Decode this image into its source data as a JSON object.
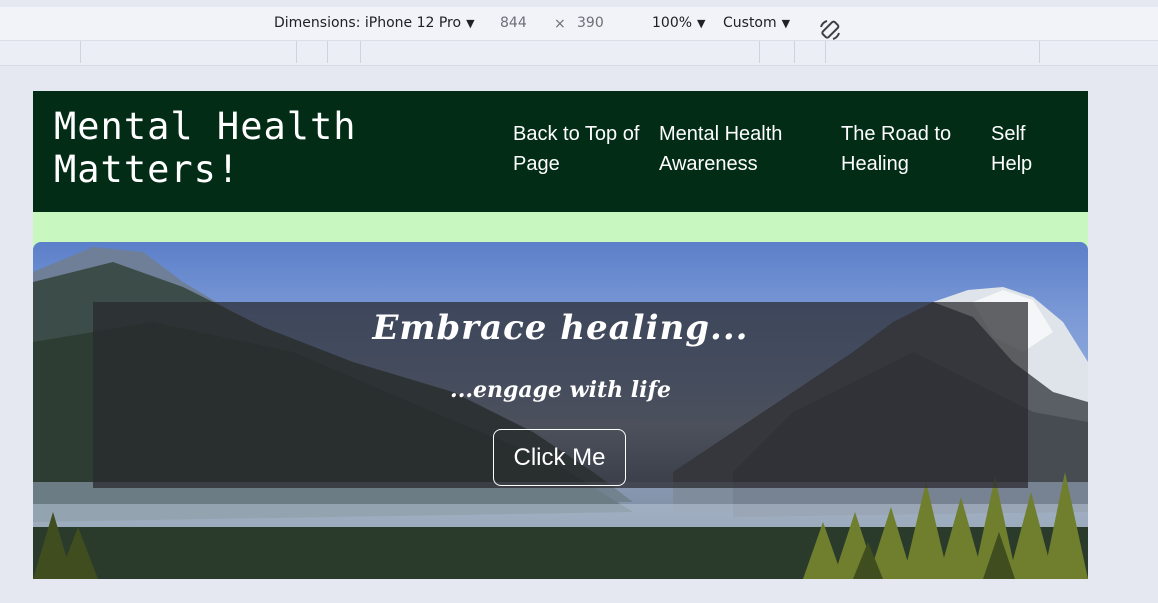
{
  "devtools": {
    "device_label": "Dimensions: iPhone 12 Pro",
    "width": "844",
    "separator": "×",
    "height": "390",
    "zoom": "100%",
    "throttle": "Custom",
    "icons": {
      "caret": "caret-down-icon",
      "rotate": "rotate-icon"
    }
  },
  "site": {
    "title": "Mental Health Matters!",
    "nav": [
      {
        "label": "Back to Top of Page"
      },
      {
        "label": "Mental Health Awareness"
      },
      {
        "label": "The Road to Healing"
      },
      {
        "label": "Self Help"
      }
    ],
    "hero": {
      "heading": "Embrace healing...",
      "subheading": "...engage with life",
      "button_label": "Click Me"
    }
  },
  "colors": {
    "header_bg": "#022c16",
    "band_bg": "#c9f7c0",
    "overlay_bg": "rgba(40,40,45,0.72)",
    "page_bg": "#e6e8f1"
  }
}
